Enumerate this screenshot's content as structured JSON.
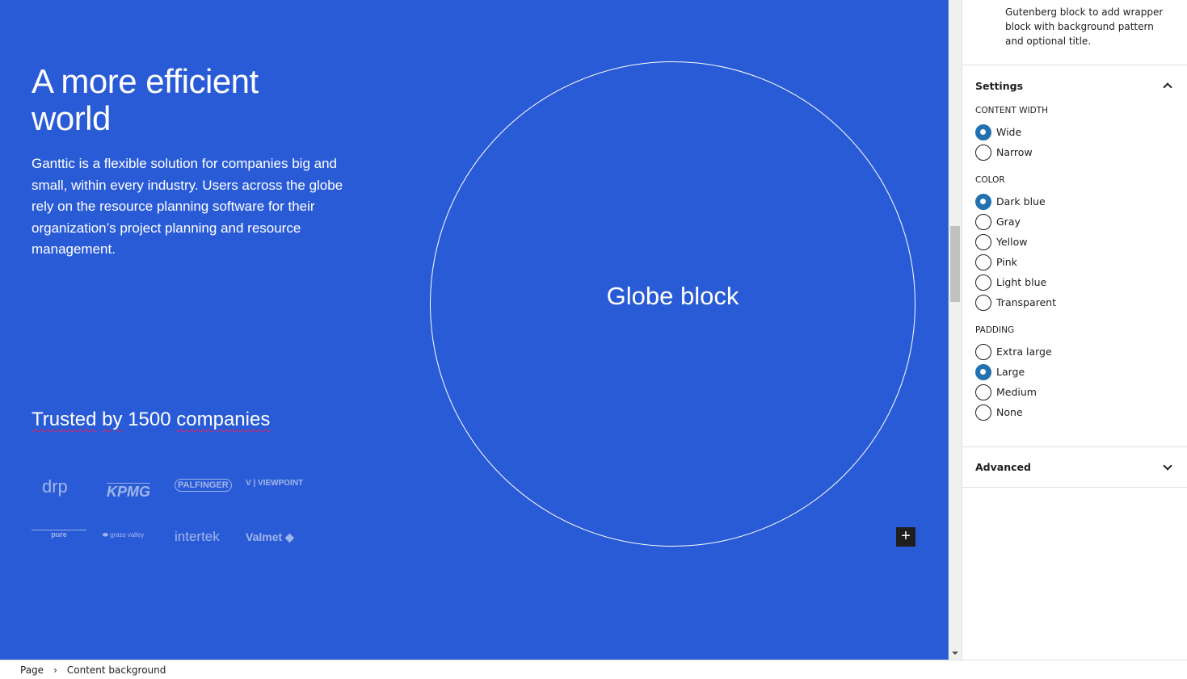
{
  "canvas": {
    "heading": "A more efficient world",
    "body": "Ganttic is a flexible solution for companies big and small, within every industry. Users across the globe rely on the resource planning software for their organization’s project planning and resource management.",
    "trusted_parts": [
      "Trusted",
      "by",
      "1500",
      "companies"
    ],
    "logos": [
      "drp",
      "KPMG",
      "PALFINGER",
      "VIEWPOINT",
      "pure",
      "grass valley",
      "intertek",
      "Valmet"
    ],
    "globe_label": "Globe block",
    "add_block_icon": "+",
    "bg_color": "#2a5bd6"
  },
  "sidebar": {
    "description": "Gutenberg block to add wrapper block with background pattern and optional title.",
    "settings_title": "Settings",
    "advanced_title": "Advanced",
    "groups": [
      {
        "label": "Content width",
        "options": [
          {
            "label": "Wide",
            "checked": true
          },
          {
            "label": "Narrow",
            "checked": false
          }
        ]
      },
      {
        "label": "Color",
        "options": [
          {
            "label": "Dark blue",
            "checked": true
          },
          {
            "label": "Gray",
            "checked": false
          },
          {
            "label": "Yellow",
            "checked": false
          },
          {
            "label": "Pink",
            "checked": false
          },
          {
            "label": "Light blue",
            "checked": false
          },
          {
            "label": "Transparent",
            "checked": false
          }
        ]
      },
      {
        "label": "Padding",
        "options": [
          {
            "label": "Extra large",
            "checked": false
          },
          {
            "label": "Large",
            "checked": true
          },
          {
            "label": "Medium",
            "checked": false
          },
          {
            "label": "None",
            "checked": false
          }
        ]
      }
    ]
  },
  "breadcrumb": {
    "items": [
      "Page",
      "Content background"
    ],
    "separator": "›"
  }
}
